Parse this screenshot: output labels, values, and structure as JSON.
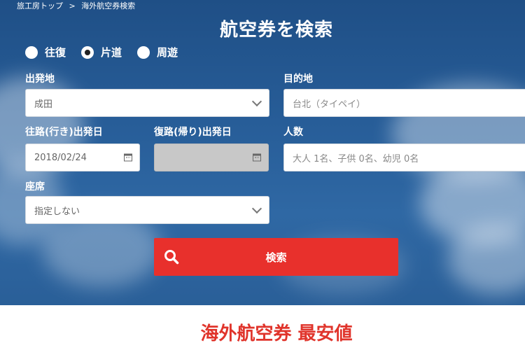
{
  "breadcrumb": {
    "home": "旅工房トップ",
    "sep": ">",
    "current": "海外航空券検索"
  },
  "title": "航空券を検索",
  "trip_types": [
    {
      "label": "往復",
      "checked": false
    },
    {
      "label": "片道",
      "checked": true
    },
    {
      "label": "周遊",
      "checked": false
    }
  ],
  "fields": {
    "departure_label": "出発地",
    "departure_value": "成田",
    "destination_label": "目的地",
    "destination_placeholder": "台北（タイペイ）",
    "outbound_label": "往路(行き)出発日",
    "outbound_value": "2018/02/24",
    "return_label": "復路(帰り)出発日",
    "return_value": "",
    "passengers_label": "人数",
    "passengers_placeholder": "大人 1名、子供 0名、幼児 0名",
    "seat_label": "座席",
    "seat_value": "指定しない"
  },
  "search_button": "検索",
  "section_title": "海外航空券 最安値",
  "colors": {
    "accent": "#e8302c",
    "hero": "#275d98"
  }
}
